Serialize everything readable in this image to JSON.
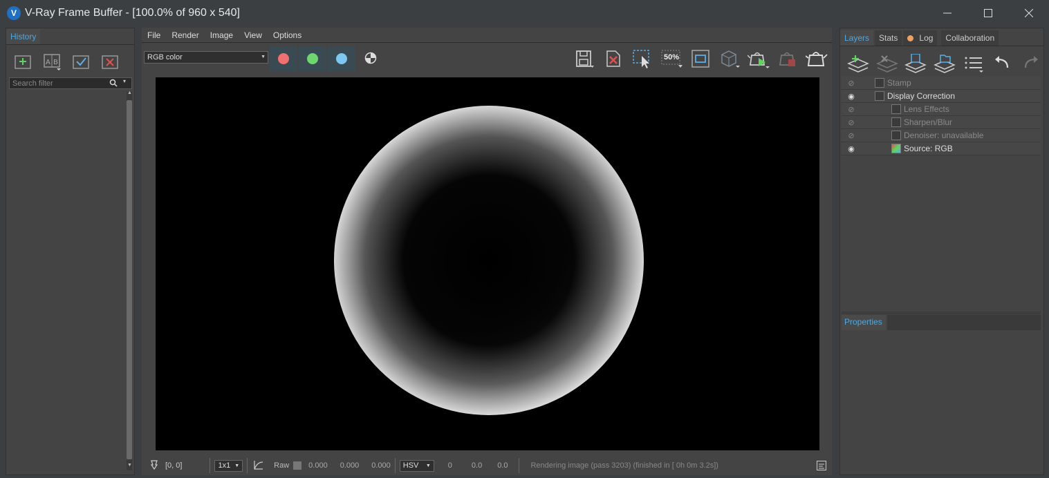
{
  "window": {
    "title": "V-Ray Frame Buffer - [100.0% of 960 x 540]",
    "logo": "V"
  },
  "history": {
    "tab": "History",
    "search_placeholder": "Search filter",
    "tools": [
      "history-add-icon",
      "ab-compare-icon",
      "history-check-icon",
      "history-delete-icon"
    ]
  },
  "menu": {
    "items": [
      "File",
      "Render",
      "Image",
      "View",
      "Options"
    ]
  },
  "toolbar": {
    "channel": "RGB color",
    "colors": {
      "red": "#f07070",
      "green": "#6ed66e",
      "blue": "#7cc8f0"
    },
    "zoom_label": "50%"
  },
  "status": {
    "coords": "[0, 0]",
    "sampling": "1x1",
    "raw_label": "Raw",
    "rgb_values": [
      "0.000",
      "0.000",
      "0.000"
    ],
    "colorspace": "HSV",
    "hsv_values": [
      "0",
      "0.0",
      "0.0"
    ],
    "message": "Rendering image (pass 3203) (finished in [ 0h  0m  3.2s])"
  },
  "right": {
    "tabs": [
      "Layers",
      "Stats",
      "Log",
      "Collaboration"
    ],
    "log_indicator_color": "#f0a060",
    "layers": [
      {
        "name": "Stamp",
        "visible": false
      },
      {
        "name": "Display Correction",
        "visible": true
      },
      {
        "name": "Lens Effects",
        "visible": false
      },
      {
        "name": "Sharpen/Blur",
        "visible": false
      },
      {
        "name": "Denoiser: unavailable",
        "visible": false
      },
      {
        "name": "Source: RGB",
        "visible": true
      }
    ],
    "properties_tab": "Properties"
  }
}
